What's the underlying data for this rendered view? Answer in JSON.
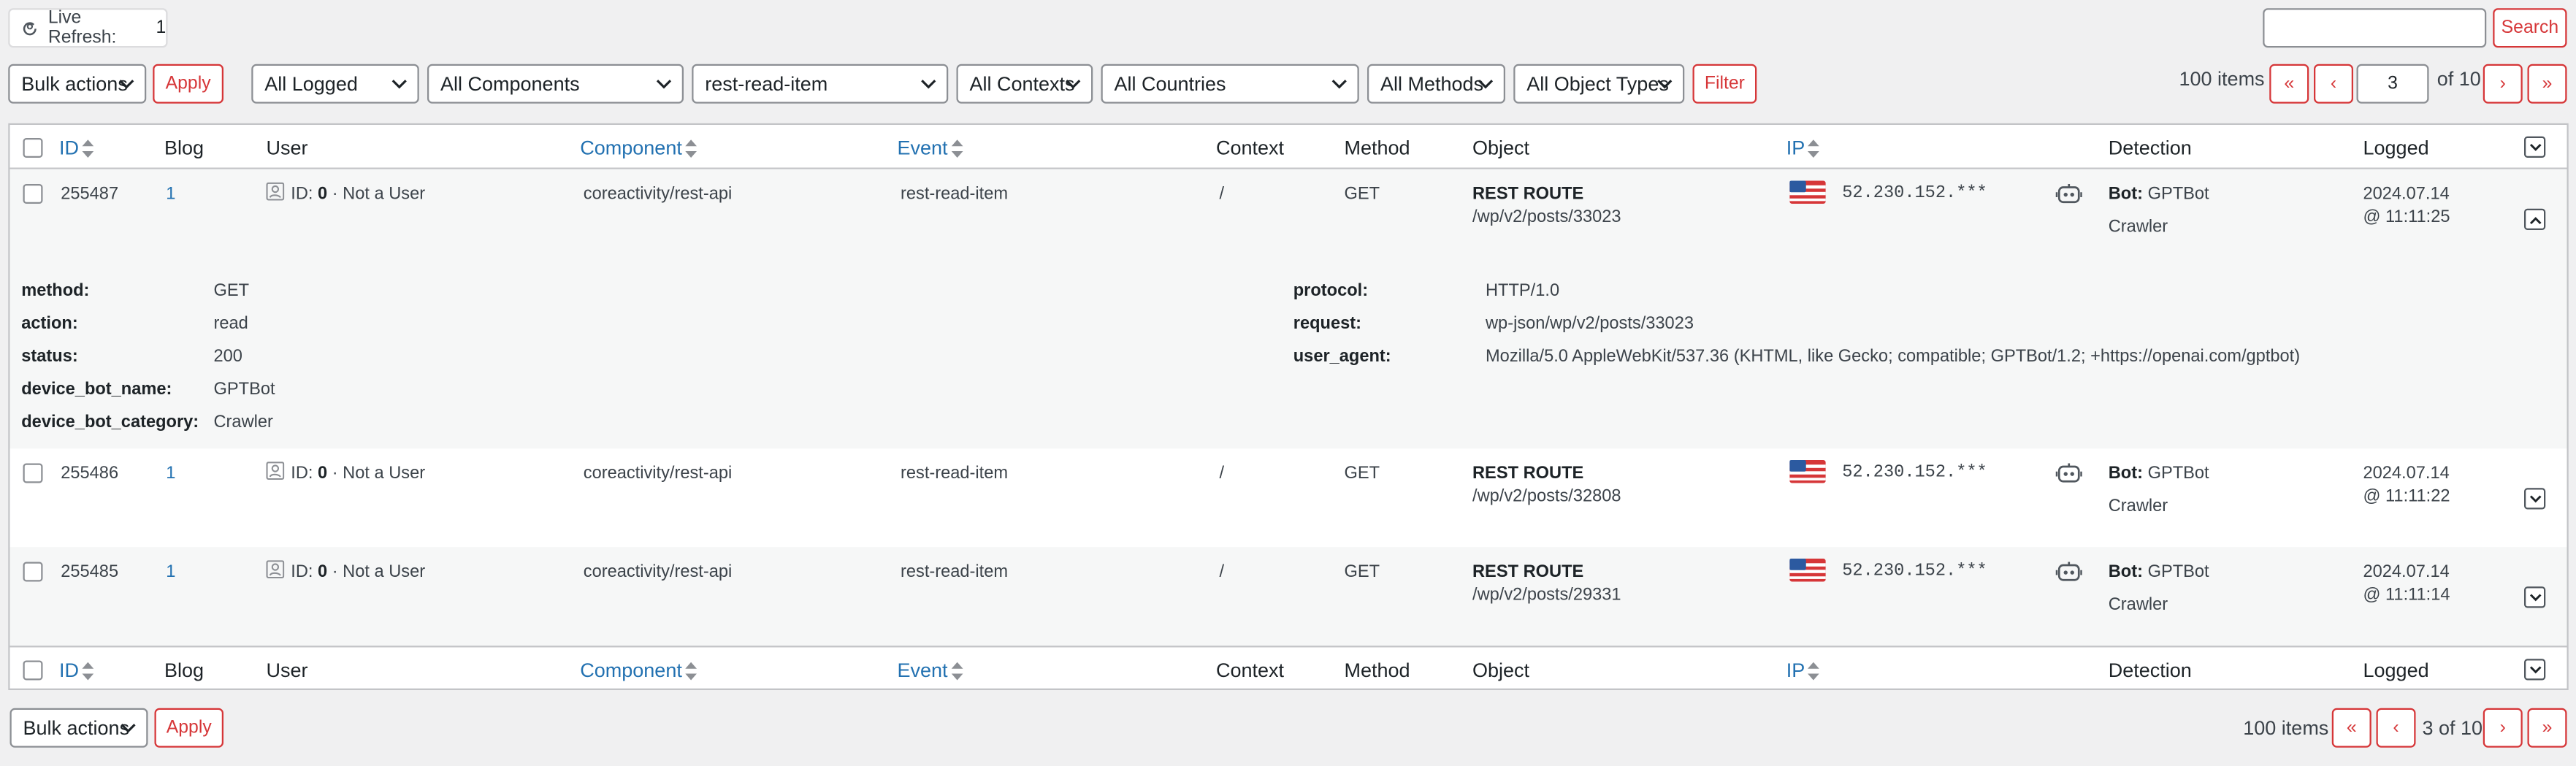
{
  "live_refresh": {
    "label": "Live Refresh:",
    "count": "1"
  },
  "search": {
    "placeholder": "",
    "button": "Search"
  },
  "bulk_actions": {
    "label": "Bulk actions",
    "apply": "Apply"
  },
  "filters": {
    "logged": "All Logged",
    "components": "All Components",
    "event": "rest-read-item",
    "contexts": "All Contexts",
    "countries": "All Countries",
    "methods": "All Methods",
    "object_types": "All Object Types",
    "filter_button": "Filter"
  },
  "pagination_top": {
    "items": "100 items",
    "first": "«",
    "prev": "‹",
    "current": "3",
    "of": "of 10",
    "next": "›",
    "last": "»"
  },
  "pagination_bottom": {
    "items": "100 items",
    "first": "«",
    "prev": "‹",
    "pages": "3 of 10",
    "next": "›",
    "last": "»"
  },
  "columns": {
    "id": "ID",
    "blog": "Blog",
    "user": "User",
    "component": "Component",
    "event": "Event",
    "context": "Context",
    "method": "Method",
    "object": "Object",
    "ip": "IP",
    "detection": "Detection",
    "logged": "Logged"
  },
  "rows": [
    {
      "id": "255487",
      "blog": "1",
      "user_id_label": "ID:",
      "user_id": "0",
      "user_name": "· Not a User",
      "component": "coreactivity/rest-api",
      "event": "rest-read-item",
      "context": "/",
      "method": "GET",
      "object_title": "REST ROUTE",
      "object_path": "/wp/v2/posts/33023",
      "ip": "52.230.152.***",
      "bot_label": "Bot:",
      "bot_name": "GPTBot",
      "bot_category": "Crawler",
      "date": "2024.07.14",
      "time": "@ 11:11:25"
    },
    {
      "id": "255486",
      "blog": "1",
      "user_id_label": "ID:",
      "user_id": "0",
      "user_name": "· Not a User",
      "component": "coreactivity/rest-api",
      "event": "rest-read-item",
      "context": "/",
      "method": "GET",
      "object_title": "REST ROUTE",
      "object_path": "/wp/v2/posts/32808",
      "ip": "52.230.152.***",
      "bot_label": "Bot:",
      "bot_name": "GPTBot",
      "bot_category": "Crawler",
      "date": "2024.07.14",
      "time": "@ 11:11:22"
    },
    {
      "id": "255485",
      "blog": "1",
      "user_id_label": "ID:",
      "user_id": "0",
      "user_name": "· Not a User",
      "component": "coreactivity/rest-api",
      "event": "rest-read-item",
      "context": "/",
      "method": "GET",
      "object_title": "REST ROUTE",
      "object_path": "/wp/v2/posts/29331",
      "ip": "52.230.152.***",
      "bot_label": "Bot:",
      "bot_name": "GPTBot",
      "bot_category": "Crawler",
      "date": "2024.07.14",
      "time": "@ 11:11:14"
    }
  ],
  "details": {
    "left": [
      {
        "key": "method:",
        "value": "GET"
      },
      {
        "key": "action:",
        "value": "read"
      },
      {
        "key": "status:",
        "value": "200"
      },
      {
        "key": "device_bot_name:",
        "value": "GPTBot"
      },
      {
        "key": "device_bot_category:",
        "value": "Crawler"
      }
    ],
    "right": [
      {
        "key": "protocol:",
        "value": "HTTP/1.0"
      },
      {
        "key": "request:",
        "value": "wp-json/wp/v2/posts/33023"
      },
      {
        "key": "user_agent:",
        "value": "Mozilla/5.0 AppleWebKit/537.36 (KHTML, like Gecko; compatible; GPTBot/1.2; +https://openai.com/gptbot)"
      }
    ]
  },
  "colors": {
    "accent": "#2271b1",
    "danger": "#d63638",
    "background": "#f0f0f1"
  }
}
